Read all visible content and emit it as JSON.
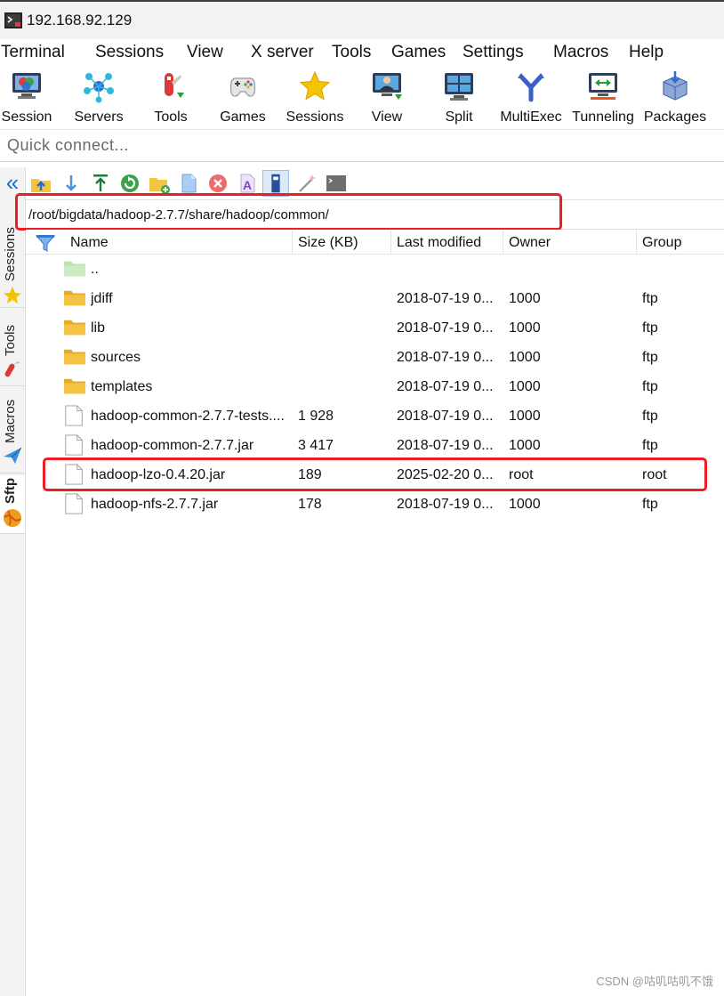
{
  "window": {
    "title": "192.168.92.129"
  },
  "menu": [
    "Terminal",
    "Sessions",
    "View",
    "X server",
    "Tools",
    "Games",
    "Settings",
    "Macros",
    "Help"
  ],
  "toolbar": [
    "Session",
    "Servers",
    "Tools",
    "Games",
    "Sessions",
    "View",
    "Split",
    "MultiExec",
    "Tunneling",
    "Packages"
  ],
  "quick_connect": {
    "placeholder": "Quick connect..."
  },
  "side_tabs": [
    "Sessions",
    "Tools",
    "Macros",
    "Sftp"
  ],
  "path": "/root/bigdata/hadoop-2.7.7/share/hadoop/common/",
  "columns": {
    "name": "Name",
    "size": "Size (KB)",
    "modified": "Last modified",
    "owner": "Owner",
    "group": "Group"
  },
  "files": [
    {
      "name": "..",
      "size": "",
      "modified": "",
      "owner": "",
      "group": "",
      "kind": "parent"
    },
    {
      "name": "jdiff",
      "size": "",
      "modified": "2018-07-19 0...",
      "owner": "1000",
      "group": "ftp",
      "kind": "folder"
    },
    {
      "name": "lib",
      "size": "",
      "modified": "2018-07-19 0...",
      "owner": "1000",
      "group": "ftp",
      "kind": "folder"
    },
    {
      "name": "sources",
      "size": "",
      "modified": "2018-07-19 0...",
      "owner": "1000",
      "group": "ftp",
      "kind": "folder"
    },
    {
      "name": "templates",
      "size": "",
      "modified": "2018-07-19 0...",
      "owner": "1000",
      "group": "ftp",
      "kind": "folder"
    },
    {
      "name": "hadoop-common-2.7.7-tests....",
      "size": "1 928",
      "modified": "2018-07-19 0...",
      "owner": "1000",
      "group": "ftp",
      "kind": "file"
    },
    {
      "name": "hadoop-common-2.7.7.jar",
      "size": "3 417",
      "modified": "2018-07-19 0...",
      "owner": "1000",
      "group": "ftp",
      "kind": "file"
    },
    {
      "name": "hadoop-lzo-0.4.20.jar",
      "size": "189",
      "modified": "2025-02-20 0...",
      "owner": "root",
      "group": "root",
      "kind": "file"
    },
    {
      "name": "hadoop-nfs-2.7.7.jar",
      "size": "178",
      "modified": "2018-07-19 0...",
      "owner": "1000",
      "group": "ftp",
      "kind": "file"
    }
  ],
  "watermark": "CSDN @咕叽咕叽不饿",
  "colors": {
    "accent": "#1a6fd4",
    "highlight_box": "#ee1c24",
    "folder": "#f5c343",
    "parent_folder": "#b9e3a9"
  }
}
